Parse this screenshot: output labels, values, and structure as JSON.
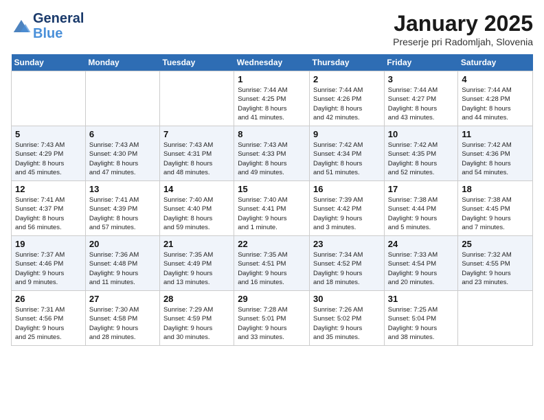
{
  "header": {
    "logo_line1": "General",
    "logo_line2": "Blue",
    "month": "January 2025",
    "location": "Preserje pri Radomljah, Slovenia"
  },
  "weekdays": [
    "Sunday",
    "Monday",
    "Tuesday",
    "Wednesday",
    "Thursday",
    "Friday",
    "Saturday"
  ],
  "weeks": [
    [
      {
        "day": "",
        "info": ""
      },
      {
        "day": "",
        "info": ""
      },
      {
        "day": "",
        "info": ""
      },
      {
        "day": "1",
        "info": "Sunrise: 7:44 AM\nSunset: 4:25 PM\nDaylight: 8 hours\nand 41 minutes."
      },
      {
        "day": "2",
        "info": "Sunrise: 7:44 AM\nSunset: 4:26 PM\nDaylight: 8 hours\nand 42 minutes."
      },
      {
        "day": "3",
        "info": "Sunrise: 7:44 AM\nSunset: 4:27 PM\nDaylight: 8 hours\nand 43 minutes."
      },
      {
        "day": "4",
        "info": "Sunrise: 7:44 AM\nSunset: 4:28 PM\nDaylight: 8 hours\nand 44 minutes."
      }
    ],
    [
      {
        "day": "5",
        "info": "Sunrise: 7:43 AM\nSunset: 4:29 PM\nDaylight: 8 hours\nand 45 minutes."
      },
      {
        "day": "6",
        "info": "Sunrise: 7:43 AM\nSunset: 4:30 PM\nDaylight: 8 hours\nand 47 minutes."
      },
      {
        "day": "7",
        "info": "Sunrise: 7:43 AM\nSunset: 4:31 PM\nDaylight: 8 hours\nand 48 minutes."
      },
      {
        "day": "8",
        "info": "Sunrise: 7:43 AM\nSunset: 4:33 PM\nDaylight: 8 hours\nand 49 minutes."
      },
      {
        "day": "9",
        "info": "Sunrise: 7:42 AM\nSunset: 4:34 PM\nDaylight: 8 hours\nand 51 minutes."
      },
      {
        "day": "10",
        "info": "Sunrise: 7:42 AM\nSunset: 4:35 PM\nDaylight: 8 hours\nand 52 minutes."
      },
      {
        "day": "11",
        "info": "Sunrise: 7:42 AM\nSunset: 4:36 PM\nDaylight: 8 hours\nand 54 minutes."
      }
    ],
    [
      {
        "day": "12",
        "info": "Sunrise: 7:41 AM\nSunset: 4:37 PM\nDaylight: 8 hours\nand 56 minutes."
      },
      {
        "day": "13",
        "info": "Sunrise: 7:41 AM\nSunset: 4:39 PM\nDaylight: 8 hours\nand 57 minutes."
      },
      {
        "day": "14",
        "info": "Sunrise: 7:40 AM\nSunset: 4:40 PM\nDaylight: 8 hours\nand 59 minutes."
      },
      {
        "day": "15",
        "info": "Sunrise: 7:40 AM\nSunset: 4:41 PM\nDaylight: 9 hours\nand 1 minute."
      },
      {
        "day": "16",
        "info": "Sunrise: 7:39 AM\nSunset: 4:42 PM\nDaylight: 9 hours\nand 3 minutes."
      },
      {
        "day": "17",
        "info": "Sunrise: 7:38 AM\nSunset: 4:44 PM\nDaylight: 9 hours\nand 5 minutes."
      },
      {
        "day": "18",
        "info": "Sunrise: 7:38 AM\nSunset: 4:45 PM\nDaylight: 9 hours\nand 7 minutes."
      }
    ],
    [
      {
        "day": "19",
        "info": "Sunrise: 7:37 AM\nSunset: 4:46 PM\nDaylight: 9 hours\nand 9 minutes."
      },
      {
        "day": "20",
        "info": "Sunrise: 7:36 AM\nSunset: 4:48 PM\nDaylight: 9 hours\nand 11 minutes."
      },
      {
        "day": "21",
        "info": "Sunrise: 7:35 AM\nSunset: 4:49 PM\nDaylight: 9 hours\nand 13 minutes."
      },
      {
        "day": "22",
        "info": "Sunrise: 7:35 AM\nSunset: 4:51 PM\nDaylight: 9 hours\nand 16 minutes."
      },
      {
        "day": "23",
        "info": "Sunrise: 7:34 AM\nSunset: 4:52 PM\nDaylight: 9 hours\nand 18 minutes."
      },
      {
        "day": "24",
        "info": "Sunrise: 7:33 AM\nSunset: 4:54 PM\nDaylight: 9 hours\nand 20 minutes."
      },
      {
        "day": "25",
        "info": "Sunrise: 7:32 AM\nSunset: 4:55 PM\nDaylight: 9 hours\nand 23 minutes."
      }
    ],
    [
      {
        "day": "26",
        "info": "Sunrise: 7:31 AM\nSunset: 4:56 PM\nDaylight: 9 hours\nand 25 minutes."
      },
      {
        "day": "27",
        "info": "Sunrise: 7:30 AM\nSunset: 4:58 PM\nDaylight: 9 hours\nand 28 minutes."
      },
      {
        "day": "28",
        "info": "Sunrise: 7:29 AM\nSunset: 4:59 PM\nDaylight: 9 hours\nand 30 minutes."
      },
      {
        "day": "29",
        "info": "Sunrise: 7:28 AM\nSunset: 5:01 PM\nDaylight: 9 hours\nand 33 minutes."
      },
      {
        "day": "30",
        "info": "Sunrise: 7:26 AM\nSunset: 5:02 PM\nDaylight: 9 hours\nand 35 minutes."
      },
      {
        "day": "31",
        "info": "Sunrise: 7:25 AM\nSunset: 5:04 PM\nDaylight: 9 hours\nand 38 minutes."
      },
      {
        "day": "",
        "info": ""
      }
    ]
  ]
}
